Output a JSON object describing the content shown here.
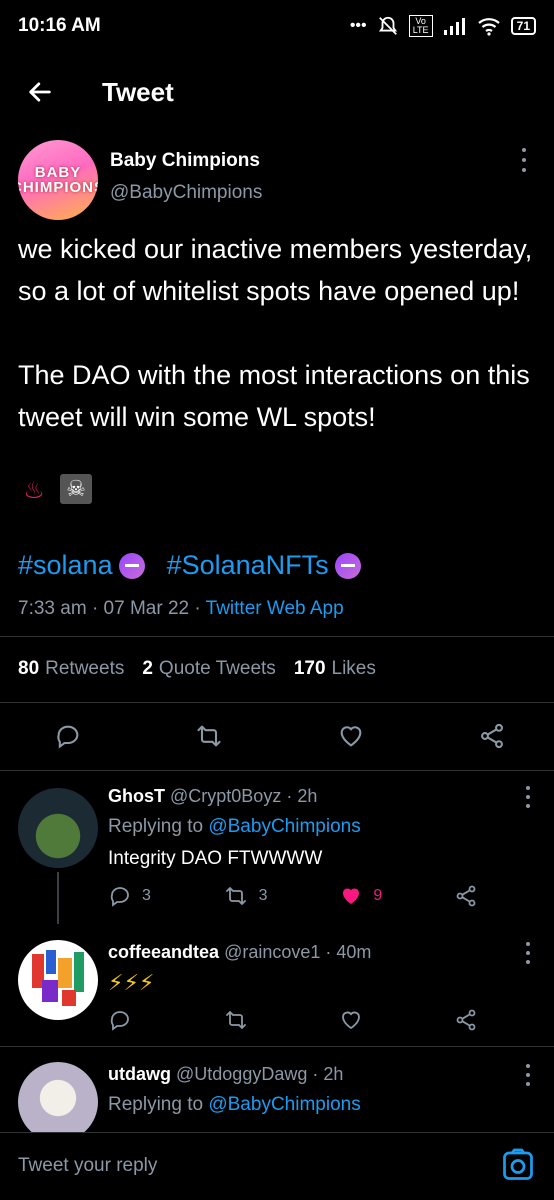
{
  "status_bar": {
    "time": "10:16 AM",
    "signal_dots": "•••",
    "volte": "Vo LTE",
    "battery": "71"
  },
  "header": {
    "title": "Tweet"
  },
  "tweet": {
    "display_name": "Baby Chimpions",
    "handle": "@BabyChimpions",
    "avatar_text": "BABY CHIMPIONS",
    "text": "we kicked our inactive members yesterday, so a lot of whitelist spots have opened up!\n\nThe DAO with the most interactions on this tweet will win some WL spots!",
    "emojis": [
      "♨",
      "☠"
    ],
    "hashtags": [
      "#solana",
      "#SolanaNFTs"
    ],
    "time": "7:33 am",
    "date": "07 Mar 22",
    "separator": "·",
    "source": "Twitter Web App",
    "stats": {
      "retweets_count": "80",
      "retweets_label": "Retweets",
      "quotes_count": "2",
      "quotes_label": "Quote Tweets",
      "likes_count": "170",
      "likes_label": "Likes"
    },
    "actions": [
      "reply-icon",
      "retweet-icon",
      "like-icon",
      "share-icon"
    ]
  },
  "replies": [
    {
      "display_name": "GhosT",
      "handle": "@Crypt0Boyz",
      "time": "· 2h",
      "replying_prefix": "Replying to",
      "replying_to": "@BabyChimpions",
      "text": "Integrity DAO FTWWWW",
      "reply_count": "3",
      "retweet_count": "3",
      "like_count": "9",
      "liked": true,
      "avatar_color": "#24303a"
    },
    {
      "display_name": "coffeeandtea",
      "handle": "@raincove1",
      "time": "· 40m",
      "text": "⚡⚡⚡",
      "reply_count": "",
      "retweet_count": "",
      "like_count": "",
      "liked": false,
      "avatar_color": "#ffffff"
    },
    {
      "display_name": "utdawg",
      "handle": "@UtdoggyDawg",
      "time": "· 2h",
      "replying_prefix": "Replying to",
      "replying_to": "@BabyChimpions",
      "avatar_color": "#b9b2c8"
    }
  ],
  "composer": {
    "placeholder": "Tweet your reply"
  },
  "colors": {
    "accent": "#1d9bf0",
    "like": "#f91880",
    "muted": "#8b98a5",
    "background": "#000000"
  }
}
